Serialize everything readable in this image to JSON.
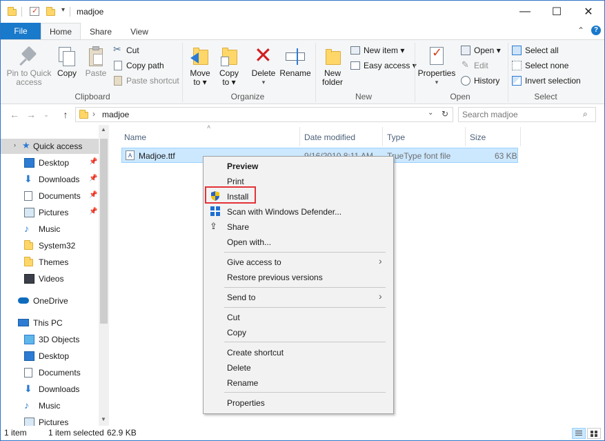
{
  "window": {
    "title": "madjoe",
    "minimize_glyph": "—",
    "maximize_glyph": "☐",
    "close_glyph": "✕"
  },
  "tabs": {
    "file": "File",
    "home": "Home",
    "share": "Share",
    "view": "View"
  },
  "ribbon": {
    "clipboard": {
      "label": "Clipboard",
      "pin_line1": "Pin to Quick",
      "pin_line2": "access",
      "copy": "Copy",
      "paste": "Paste",
      "cut": "Cut",
      "copy_path": "Copy path",
      "paste_shortcut": "Paste shortcut"
    },
    "organize": {
      "label": "Organize",
      "move_line1": "Move",
      "move_line2": "to ▾",
      "copy_line1": "Copy",
      "copy_line2": "to ▾",
      "delete": "Delete",
      "rename": "Rename"
    },
    "new": {
      "label": "New",
      "new_folder_line1": "New",
      "new_folder_line2": "folder",
      "new_item": "New item ▾",
      "easy_access": "Easy access ▾"
    },
    "open": {
      "label": "Open",
      "properties": "Properties",
      "open": "Open ▾",
      "edit": "Edit",
      "history": "History"
    },
    "select": {
      "label": "Select",
      "select_all": "Select all",
      "select_none": "Select none",
      "invert_selection": "Invert selection"
    }
  },
  "address": {
    "path": "madjoe",
    "search_placeholder": "Search madjoe"
  },
  "navpane": {
    "quick_access": "Quick access",
    "items": [
      {
        "label": "Desktop",
        "icon": "desktop-icon",
        "pinned": true
      },
      {
        "label": "Downloads",
        "icon": "downloads-icon",
        "pinned": true
      },
      {
        "label": "Documents",
        "icon": "documents-icon",
        "pinned": true
      },
      {
        "label": "Pictures",
        "icon": "pictures-icon",
        "pinned": true
      },
      {
        "label": "Music",
        "icon": "music-icon",
        "pinned": false
      },
      {
        "label": "System32",
        "icon": "folder-icon",
        "pinned": false
      },
      {
        "label": "Themes",
        "icon": "folder-icon",
        "pinned": false
      },
      {
        "label": "Videos",
        "icon": "videos-icon",
        "pinned": false
      }
    ],
    "onedrive": "OneDrive",
    "this_pc": "This PC",
    "pc_items": [
      {
        "label": "3D Objects",
        "icon": "3d-objects-icon"
      },
      {
        "label": "Desktop",
        "icon": "desktop-icon"
      },
      {
        "label": "Documents",
        "icon": "documents-icon"
      },
      {
        "label": "Downloads",
        "icon": "downloads-icon"
      },
      {
        "label": "Music",
        "icon": "music-icon"
      },
      {
        "label": "Pictures",
        "icon": "pictures-icon"
      }
    ]
  },
  "filelist": {
    "columns": {
      "name": "Name",
      "date": "Date modified",
      "type": "Type",
      "size": "Size"
    },
    "rows": [
      {
        "name": "Madjoe.ttf",
        "date": "9/16/2010 8:11 AM",
        "type": "TrueType font file",
        "size": "63 KB"
      }
    ]
  },
  "status": {
    "count": "1 item",
    "selected": "1 item selected",
    "size": "62.9 KB"
  },
  "context_menu": {
    "preview": "Preview",
    "print": "Print",
    "install": "Install",
    "scan": "Scan with Windows Defender...",
    "share": "Share",
    "open_with": "Open with...",
    "give_access": "Give access to",
    "restore": "Restore previous versions",
    "send_to": "Send to",
    "cut": "Cut",
    "copy": "Copy",
    "create_shortcut": "Create shortcut",
    "delete": "Delete",
    "rename": "Rename",
    "properties": "Properties"
  },
  "colors": {
    "accent": "#1979ca",
    "selection": "#cce8ff",
    "highlight_outline": "#e23237"
  }
}
